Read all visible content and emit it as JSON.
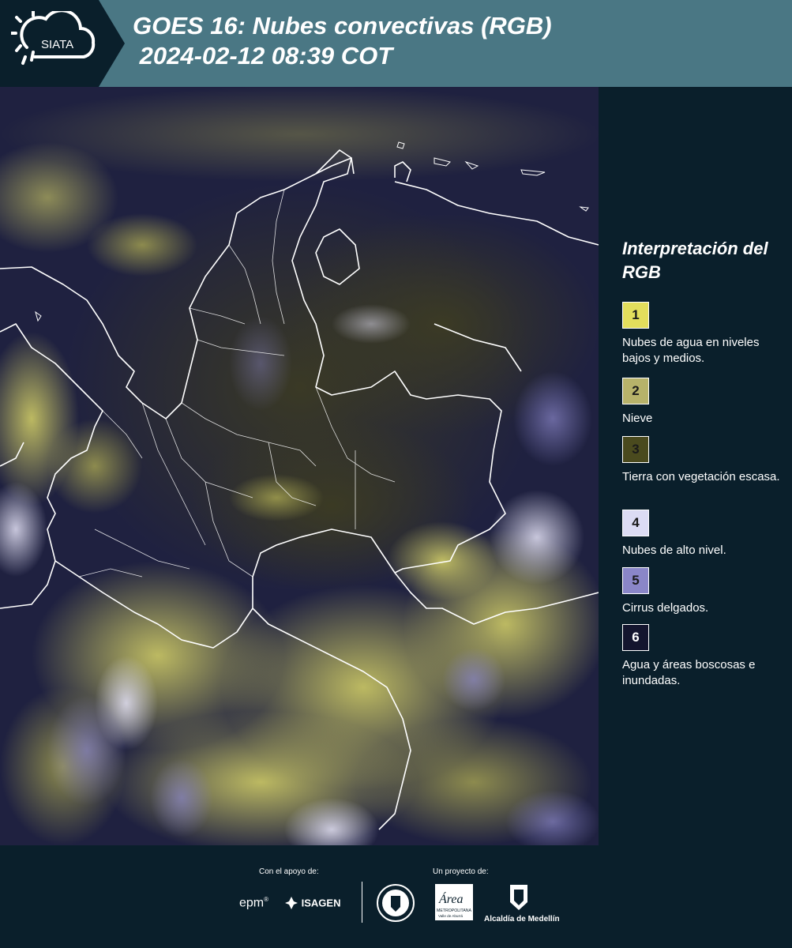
{
  "header": {
    "logo_text": "SIATA",
    "title_line1": "GOES 16: Nubes convectivas (RGB)",
    "title_line2": " 2024-02-12 08:39 COT"
  },
  "legend": {
    "title": "Interpretación del RGB",
    "items": [
      {
        "number": "1",
        "text": "Nubes de agua en niveles bajos y medios.",
        "color": "#e3de5c"
      },
      {
        "number": "2",
        "text": "Nieve",
        "color": "#b7b26a"
      },
      {
        "number": "3",
        "text": "Tierra con vegetación escasa.",
        "color": "#4a4a1e"
      },
      {
        "number": "4",
        "text": "Nubes de alto nivel.",
        "color": "#dcdcf4"
      },
      {
        "number": "5",
        "text": "Cirrus delgados.",
        "color": "#8a86c8"
      },
      {
        "number": "6",
        "text": "Agua y áreas boscosas e inundadas.",
        "color": "#14152e"
      }
    ]
  },
  "footer": {
    "support_label": "Con el apoyo de:",
    "project_label": "Un proyecto de:",
    "sponsor_epm": "epm",
    "sponsor_isagen": "ISAGEN",
    "logo_area": "Área",
    "logo_area_sub": "METROPOLITANA",
    "logo_area_sub2": "Valle de Aburrá",
    "logo_alcaldia": "Alcaldía de Medellín"
  },
  "map": {
    "icons": [
      "satellite-image",
      "country-borders"
    ]
  }
}
